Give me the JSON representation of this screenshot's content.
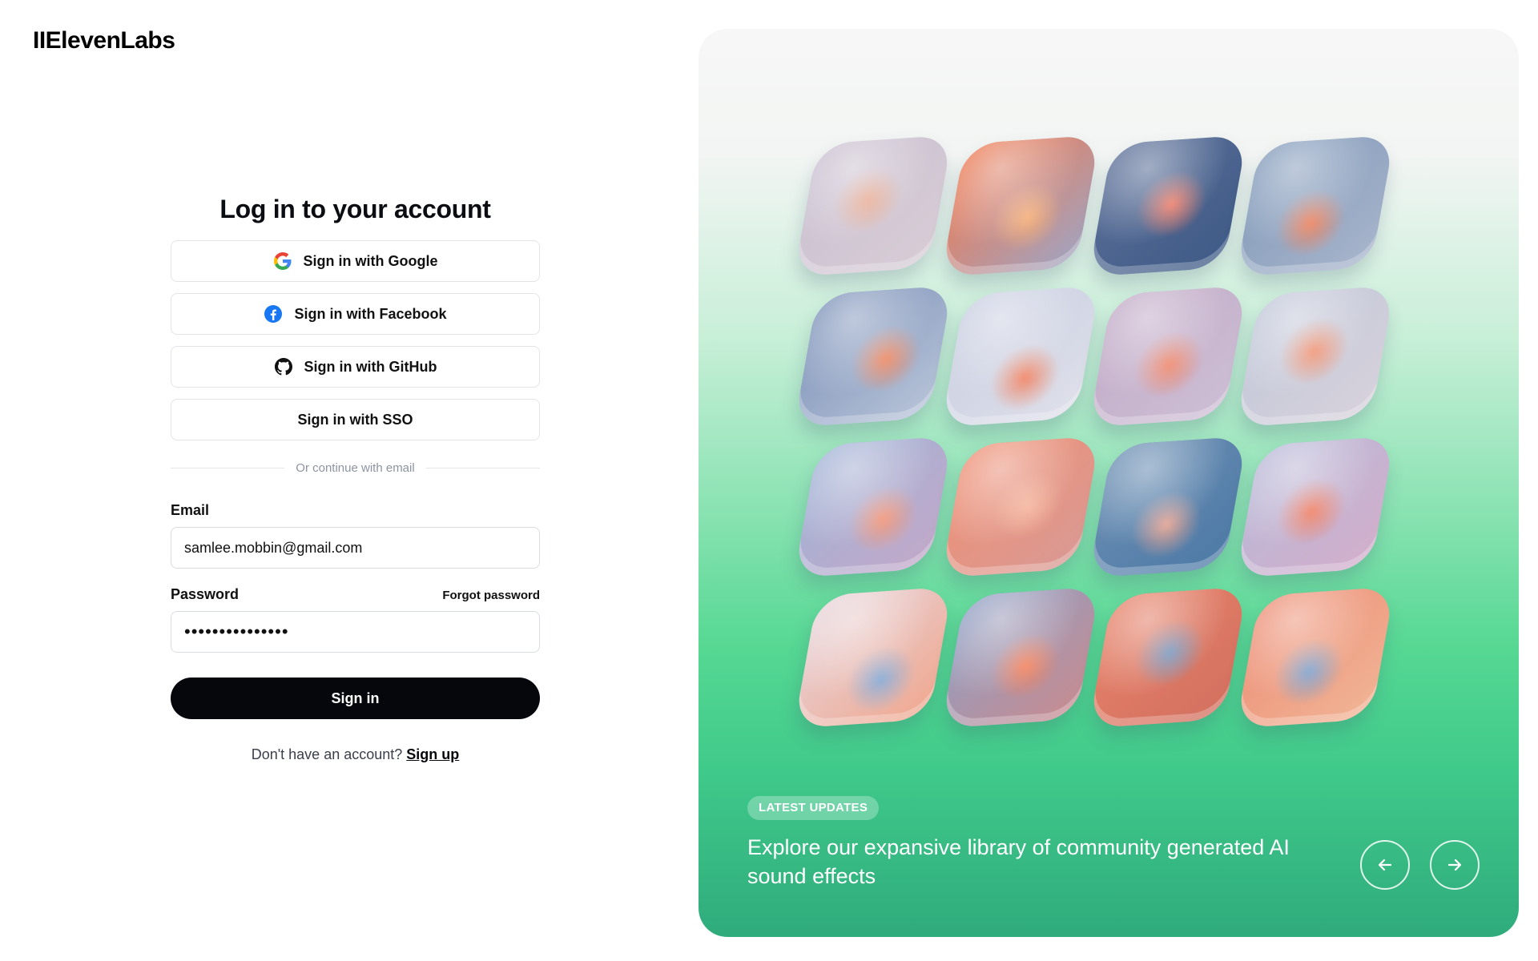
{
  "brand": {
    "logo_text": "IIElevenLabs"
  },
  "login": {
    "title": "Log in to your account",
    "google_label": "Sign in with Google",
    "facebook_label": "Sign in with Facebook",
    "github_label": "Sign in with GitHub",
    "sso_label": "Sign in with SSO",
    "divider_text": "Or continue with email",
    "email_label": "Email",
    "email_value": "samlee.mobbin@gmail.com",
    "password_label": "Password",
    "forgot_label": "Forgot password",
    "password_value": "•••••••••••••••",
    "submit_label": "Sign in",
    "no_account_text": "Don't have an account?",
    "signup_label": "Sign up"
  },
  "hero": {
    "badge": "LATEST UPDATES",
    "caption": "Explore our expansive library of community generated AI sound effects",
    "prev_icon": "arrow-left-icon",
    "next_icon": "arrow-right-icon",
    "tiles": [
      {
        "name": "rooster-tile",
        "c1": "#c9bfd0",
        "c2": "#e8a88d",
        "c3": "#d8cdd6"
      },
      {
        "name": "explosion-tile",
        "c1": "#f2774b",
        "c2": "#f6b27c",
        "c3": "#9fa5c4"
      },
      {
        "name": "fireworks-tile",
        "c1": "#5c6f98",
        "c2": "#f07a63",
        "c3": "#3d5a86"
      },
      {
        "name": "footprints-tile",
        "c1": "#7f98b8",
        "c2": "#ee8560",
        "c3": "#a9b5cc"
      },
      {
        "name": "newtons-cradle-tile",
        "c1": "#7a8fb7",
        "c2": "#f08a63",
        "c3": "#b9c5d9"
      },
      {
        "name": "helicopter-tile",
        "c1": "#c7cde0",
        "c2": "#f18b6d",
        "c3": "#dfe0ea"
      },
      {
        "name": "heart-tile",
        "c1": "#c1a9c6",
        "c2": "#f0876a",
        "c3": "#cdbfd5"
      },
      {
        "name": "race-car-tile",
        "c1": "#bfc6d8",
        "c2": "#f08a66",
        "c3": "#d8d2dc"
      },
      {
        "name": "spring-tile",
        "c1": "#9fb3d6",
        "c2": "#f39a7c",
        "c3": "#c3a8c9"
      },
      {
        "name": "alarm-clock-tile",
        "c1": "#ef8f73",
        "c2": "#f4b39a",
        "c3": "#d99a95"
      },
      {
        "name": "ocean-wave-tile",
        "c1": "#6d8fb3",
        "c2": "#e6a594",
        "c3": "#4c79a6"
      },
      {
        "name": "rooster-splash-tile",
        "c1": "#b7b9d8",
        "c2": "#f07a5c",
        "c3": "#d3aecb"
      },
      {
        "name": "phone-tile",
        "c1": "#e6d6de",
        "c2": "#8fb0d8",
        "c3": "#f0a78e"
      },
      {
        "name": "car-crash-tile",
        "c1": "#8b9fc6",
        "c2": "#f4845e",
        "c3": "#c98b8f"
      },
      {
        "name": "boxer-tile",
        "c1": "#e7836a",
        "c2": "#6f93bd",
        "c3": "#d26f5f"
      },
      {
        "name": "monster-mouth-tile",
        "c1": "#ec8c74",
        "c2": "#7ea3cf",
        "c3": "#f1b596"
      }
    ]
  }
}
